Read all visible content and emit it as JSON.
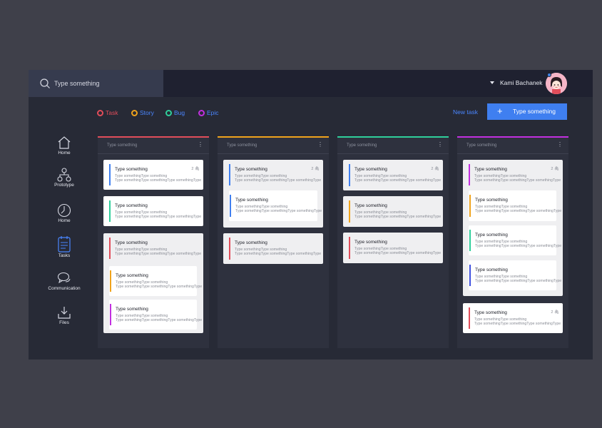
{
  "search": {
    "placeholder": "Type something"
  },
  "user": {
    "name": "Kami Bachanek"
  },
  "sidebar": {
    "items": [
      {
        "label": "Home",
        "icon": "home-icon"
      },
      {
        "label": "Prototype",
        "icon": "sitemap-icon"
      },
      {
        "label": "Home",
        "icon": "clock-icon"
      },
      {
        "label": "Tasks",
        "icon": "clipboard-icon"
      },
      {
        "label": "Communication",
        "icon": "chat-icon"
      },
      {
        "label": "Files",
        "icon": "download-icon"
      }
    ]
  },
  "legend": [
    {
      "label": "Task",
      "color": "#e14d5a"
    },
    {
      "label": "Story",
      "color": "#f0a31c"
    },
    {
      "label": "Bug",
      "color": "#2fcf9b"
    },
    {
      "label": "Epic",
      "color": "#c22fe0"
    }
  ],
  "toolbar": {
    "new_task_label": "New task",
    "primary_label": "Type something"
  },
  "columns": [
    {
      "title": "Type something",
      "color": "#e14d5a",
      "cards": [
        {
          "title": "Type something",
          "lines": [
            "Type somethingType something",
            "Type somethingType somethingType somethingType"
          ],
          "accent": "#3f7ff0",
          "meta": "2"
        },
        {
          "title": "Type something",
          "lines": [
            "Type somethingType something",
            "Type somethingType somethingType somethingType"
          ],
          "accent": "#2fcf9b"
        },
        {
          "title": "Type something",
          "lines": [
            "Type somethingType something",
            "Type somethingType somethingType somethingType"
          ],
          "accent": "#e14d5a"
        },
        {
          "title": "Type something",
          "lines": [
            "Type somethingType something",
            "Type somethingType somethingType somethingType"
          ],
          "accent": "#f0a31c"
        },
        {
          "title": "Type something",
          "lines": [
            "Type somethingType something",
            "Type somethingType somethingType somethingType"
          ],
          "accent": "#c22fe0"
        }
      ]
    },
    {
      "title": "Type something",
      "color": "#f0a31c",
      "cards": [
        {
          "title": "Type something",
          "lines": [
            "Type somethingType something",
            "Type somethingType somethingType somethingType"
          ],
          "accent": "#3f7ff0",
          "meta": "2"
        },
        {
          "title": "Type something",
          "lines": [
            "Type somethingType something",
            "Type somethingType somethingType somethingType"
          ],
          "accent": "#3f7ff0"
        },
        {
          "title": "Type something",
          "lines": [
            "Type somethingType something",
            "Type somethingType somethingType somethingType"
          ],
          "accent": "#e14d5a"
        }
      ]
    },
    {
      "title": "Type something",
      "color": "#2fcf9b",
      "cards": [
        {
          "title": "Type something",
          "lines": [
            "Type somethingType something",
            "Type somethingType somethingType somethingType"
          ],
          "accent": "#3f7ff0",
          "meta": "2"
        },
        {
          "title": "Type something",
          "lines": [
            "Type somethingType something",
            "Type somethingType somethingType somethingType"
          ],
          "accent": "#f0a31c"
        },
        {
          "title": "Type something",
          "lines": [
            "Type somethingType something",
            "Type somethingType somethingType somethingType"
          ],
          "accent": "#e14d5a"
        }
      ]
    },
    {
      "title": "Type something",
      "color": "#c22fe0",
      "cards": [
        {
          "title": "Type something",
          "lines": [
            "Type somethingType something",
            "Type somethingType somethingType somethingType"
          ],
          "accent": "#c22fe0",
          "meta": "2"
        },
        {
          "title": "Type something",
          "lines": [
            "Type somethingType something",
            "Type somethingType somethingType somethingType"
          ],
          "accent": "#f0a31c"
        },
        {
          "title": "Type something",
          "lines": [
            "Type somethingType something",
            "Type somethingType somethingType somethingType"
          ],
          "accent": "#2fcf9b"
        },
        {
          "title": "Type something",
          "lines": [
            "Type somethingType something",
            "Type somethingType somethingType somethingType"
          ],
          "accent": "#3f50e0"
        },
        {
          "title": "Type something",
          "lines": [
            "Type somethingType something",
            "Type somethingType somethingType somethingType"
          ],
          "accent": "#e14d5a",
          "meta": "2"
        }
      ]
    }
  ]
}
